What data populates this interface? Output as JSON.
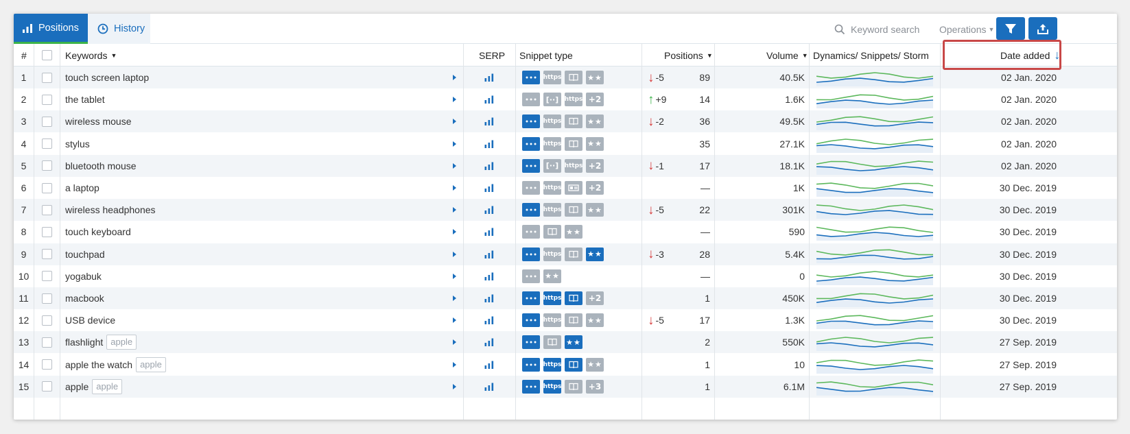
{
  "tabs": {
    "positions": "Positions",
    "history": "History"
  },
  "toolbar": {
    "search_placeholder": "Keyword search",
    "operations": "Operations"
  },
  "columns": {
    "num": "#",
    "keywords": "Keywords",
    "serp": "SERP",
    "snippet": "Snippet type",
    "positions": "Positions",
    "volume": "Volume",
    "dynamics": "Dynamics/ Snippets/ Storm",
    "date": "Date added"
  },
  "colors": {
    "accent": "#1a6ebd",
    "green": "#3cb34a",
    "red": "#d63c3c",
    "highlight": "#c84848"
  },
  "rows": [
    {
      "n": "1",
      "kw": "touch screen laptop",
      "tag": "",
      "snips": [
        [
          "dots",
          "on"
        ],
        [
          "https",
          "off"
        ],
        [
          "book",
          "off"
        ],
        [
          "stars",
          "off"
        ]
      ],
      "dir": "down",
      "delta": "-5",
      "pos": "89",
      "vol": "40.5K",
      "date": "02 Jan. 2020"
    },
    {
      "n": "2",
      "kw": "the tablet",
      "tag": "",
      "snips": [
        [
          "brackets",
          "off"
        ],
        [
          "brackets2",
          "off"
        ],
        [
          "https",
          "off"
        ],
        [
          "+2",
          "off"
        ]
      ],
      "dir": "up",
      "delta": "+9",
      "pos": "14",
      "vol": "1.6K",
      "date": "02 Jan. 2020"
    },
    {
      "n": "3",
      "kw": "wireless mouse",
      "tag": "",
      "snips": [
        [
          "dots",
          "on"
        ],
        [
          "https",
          "off"
        ],
        [
          "book",
          "off"
        ],
        [
          "stars",
          "off"
        ]
      ],
      "dir": "down",
      "delta": "-2",
      "pos": "36",
      "vol": "49.5K",
      "date": "02 Jan. 2020"
    },
    {
      "n": "4",
      "kw": "stylus",
      "tag": "",
      "snips": [
        [
          "dots",
          "on"
        ],
        [
          "https",
          "off"
        ],
        [
          "book",
          "off"
        ],
        [
          "stars",
          "off"
        ]
      ],
      "dir": "",
      "delta": "",
      "pos": "35",
      "vol": "27.1K",
      "date": "02 Jan. 2020"
    },
    {
      "n": "5",
      "kw": "bluetooth mouse",
      "tag": "",
      "snips": [
        [
          "dots",
          "on"
        ],
        [
          "brackets2",
          "off"
        ],
        [
          "https",
          "off"
        ],
        [
          "+2",
          "off"
        ]
      ],
      "dir": "down",
      "delta": "-1",
      "pos": "17",
      "vol": "18.1K",
      "date": "02 Jan. 2020"
    },
    {
      "n": "6",
      "kw": "a laptop",
      "tag": "",
      "snips": [
        [
          "dots",
          "off"
        ],
        [
          "https",
          "off"
        ],
        [
          "card",
          "off"
        ],
        [
          "+2",
          "off"
        ]
      ],
      "dir": "",
      "delta": "",
      "pos": "—",
      "vol": "1K",
      "date": "30 Dec. 2019"
    },
    {
      "n": "7",
      "kw": "wireless headphones",
      "tag": "",
      "snips": [
        [
          "dots",
          "on"
        ],
        [
          "https",
          "off"
        ],
        [
          "book",
          "off"
        ],
        [
          "stars",
          "off"
        ]
      ],
      "dir": "down",
      "delta": "-5",
      "pos": "22",
      "vol": "301K",
      "date": "30 Dec. 2019"
    },
    {
      "n": "8",
      "kw": "touch keyboard",
      "tag": "",
      "snips": [
        [
          "dots",
          "off"
        ],
        [
          "book",
          "off"
        ],
        [
          "stars",
          "off"
        ]
      ],
      "dir": "",
      "delta": "",
      "pos": "—",
      "vol": "590",
      "date": "30 Dec. 2019"
    },
    {
      "n": "9",
      "kw": "touchpad",
      "tag": "",
      "snips": [
        [
          "dots",
          "on"
        ],
        [
          "https",
          "off"
        ],
        [
          "book",
          "off"
        ],
        [
          "stars",
          "on"
        ]
      ],
      "dir": "down",
      "delta": "-3",
      "pos": "28",
      "vol": "5.4K",
      "date": "30 Dec. 2019"
    },
    {
      "n": "10",
      "kw": "yogabuk",
      "tag": "",
      "snips": [
        [
          "dots",
          "off"
        ],
        [
          "stars",
          "off"
        ]
      ],
      "dir": "",
      "delta": "",
      "pos": "—",
      "vol": "0",
      "date": "30 Dec. 2019"
    },
    {
      "n": "11",
      "kw": "macbook",
      "tag": "",
      "snips": [
        [
          "dots",
          "on"
        ],
        [
          "https",
          "on"
        ],
        [
          "book",
          "on"
        ],
        [
          "+2",
          "off"
        ]
      ],
      "dir": "",
      "delta": "",
      "pos": "1",
      "vol": "450K",
      "date": "30 Dec. 2019"
    },
    {
      "n": "12",
      "kw": "USB device",
      "tag": "",
      "snips": [
        [
          "dots",
          "on"
        ],
        [
          "https",
          "off"
        ],
        [
          "book",
          "off"
        ],
        [
          "stars",
          "off"
        ]
      ],
      "dir": "down",
      "delta": "-5",
      "pos": "17",
      "vol": "1.3K",
      "date": "30 Dec. 2019"
    },
    {
      "n": "13",
      "kw": "flashlight",
      "tag": "apple",
      "snips": [
        [
          "dots",
          "on"
        ],
        [
          "book",
          "off"
        ],
        [
          "stars",
          "on"
        ]
      ],
      "dir": "",
      "delta": "",
      "pos": "2",
      "vol": "550K",
      "date": "27 Sep. 2019"
    },
    {
      "n": "14",
      "kw": "apple the watch",
      "tag": "apple",
      "snips": [
        [
          "dots",
          "on"
        ],
        [
          "https",
          "on"
        ],
        [
          "book",
          "on"
        ],
        [
          "stars",
          "off"
        ]
      ],
      "dir": "",
      "delta": "",
      "pos": "1",
      "vol": "10",
      "date": "27 Sep. 2019"
    },
    {
      "n": "15",
      "kw": "apple",
      "tag": "apple",
      "snips": [
        [
          "dots",
          "on"
        ],
        [
          "https",
          "on"
        ],
        [
          "book",
          "off"
        ],
        [
          "+3",
          "off"
        ]
      ],
      "dir": "",
      "delta": "",
      "pos": "1",
      "vol": "6.1M",
      "date": "27 Sep. 2019"
    }
  ]
}
